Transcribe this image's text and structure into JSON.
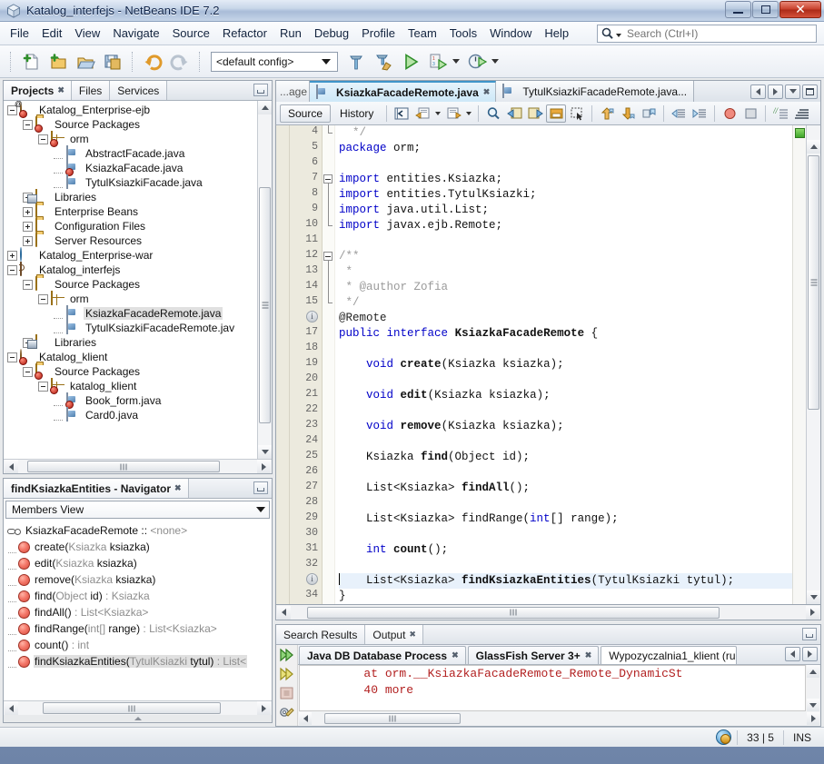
{
  "window": {
    "title": "Katalog_interfejs - NetBeans IDE 7.2",
    "app_icon": "netbeans-cube-icon",
    "minimize_label": "Minimize",
    "maximize_label": "Maximize",
    "close_label": "Close"
  },
  "menubar": {
    "items": [
      "File",
      "Edit",
      "View",
      "Navigate",
      "Source",
      "Refactor",
      "Run",
      "Debug",
      "Profile",
      "Team",
      "Tools",
      "Window",
      "Help"
    ]
  },
  "search": {
    "placeholder": "Search (Ctrl+I)",
    "value": "",
    "icon": "search-icon"
  },
  "toolbar": {
    "buttons": [
      {
        "name": "new-file-button",
        "icon": "new-file-icon",
        "label": "New File"
      },
      {
        "name": "new-project-button",
        "icon": "new-project-icon",
        "label": "New Project"
      },
      {
        "name": "open-project-button",
        "icon": "open-project-icon",
        "label": "Open Project"
      },
      {
        "name": "save-all-button",
        "icon": "save-all-icon",
        "label": "Save All"
      },
      {
        "name": "undo-button",
        "icon": "undo-icon",
        "label": "Undo"
      },
      {
        "name": "redo-button",
        "icon": "redo-icon",
        "label": "Redo"
      }
    ],
    "config_selector": {
      "value": "<default config>",
      "name": "config-selector"
    },
    "run_buttons": [
      {
        "name": "build-project-button",
        "icon": "hammer-icon",
        "label": "Build Project"
      },
      {
        "name": "clean-build-button",
        "icon": "hammer-broom-icon",
        "label": "Clean and Build Project"
      },
      {
        "name": "run-project-button",
        "icon": "play-icon",
        "label": "Run Project"
      },
      {
        "name": "debug-project-button",
        "icon": "debug-icon",
        "label": "Debug Project"
      },
      {
        "name": "profile-project-button",
        "icon": "profile-icon",
        "label": "Profile Project"
      }
    ]
  },
  "projects_panel": {
    "tabs": [
      {
        "label": "Projects",
        "active": true,
        "closable": true
      },
      {
        "label": "Files",
        "active": false,
        "closable": false
      },
      {
        "label": "Services",
        "active": false,
        "closable": false
      }
    ],
    "minimize_icon": "minimize-panel-icon",
    "tree": [
      {
        "label": "Katalog_Enterprise-ejb",
        "depth": 0,
        "state": "expanded",
        "icon": "ejb-module-icon",
        "badge": "error"
      },
      {
        "label": "Source Packages",
        "depth": 1,
        "state": "expanded",
        "icon": "source-packages-icon",
        "badge": "error"
      },
      {
        "label": "orm",
        "depth": 2,
        "state": "expanded",
        "icon": "package-icon",
        "badge": "error"
      },
      {
        "label": "AbstractFacade.java",
        "depth": 3,
        "state": "leaf",
        "icon": "java-file-icon",
        "badge": "none"
      },
      {
        "label": "KsiazkaFacade.java",
        "depth": 3,
        "state": "leaf",
        "icon": "java-file-icon",
        "badge": "error"
      },
      {
        "label": "TytulKsiazkiFacade.java",
        "depth": 3,
        "state": "leaf",
        "icon": "java-file-icon",
        "badge": "none"
      },
      {
        "label": "Libraries",
        "depth": 1,
        "state": "collapsed",
        "icon": "libraries-icon",
        "badge": "none"
      },
      {
        "label": "Enterprise Beans",
        "depth": 1,
        "state": "collapsed",
        "icon": "enterprise-beans-icon",
        "badge": "none"
      },
      {
        "label": "Configuration Files",
        "depth": 1,
        "state": "collapsed",
        "icon": "config-files-icon",
        "badge": "none"
      },
      {
        "label": "Server Resources",
        "depth": 1,
        "state": "collapsed",
        "icon": "server-resources-icon",
        "badge": "none"
      },
      {
        "label": "Katalog_Enterprise-war",
        "depth": 0,
        "state": "collapsed",
        "icon": "web-module-icon",
        "badge": "none"
      },
      {
        "label": "Katalog_interfejs",
        "depth": 0,
        "state": "expanded",
        "icon": "java-project-icon",
        "badge": "none"
      },
      {
        "label": "Source Packages",
        "depth": 1,
        "state": "expanded",
        "icon": "source-packages-icon",
        "badge": "none"
      },
      {
        "label": "orm",
        "depth": 2,
        "state": "expanded",
        "icon": "package-icon",
        "badge": "none"
      },
      {
        "label": "KsiazkaFacadeRemote.java",
        "depth": 3,
        "state": "leaf",
        "icon": "java-file-icon",
        "badge": "none",
        "selected": true
      },
      {
        "label": "TytulKsiazkiFacadeRemote.jav",
        "depth": 3,
        "state": "leaf",
        "icon": "java-file-icon",
        "badge": "none"
      },
      {
        "label": "Libraries",
        "depth": 1,
        "state": "collapsed",
        "icon": "libraries-icon",
        "badge": "none"
      },
      {
        "label": "Katalog_klient",
        "depth": 0,
        "state": "expanded",
        "icon": "client-project-icon",
        "badge": "error"
      },
      {
        "label": "Source Packages",
        "depth": 1,
        "state": "expanded",
        "icon": "source-packages-icon",
        "badge": "error"
      },
      {
        "label": "katalog_klient",
        "depth": 2,
        "state": "expanded",
        "icon": "package-icon",
        "badge": "error"
      },
      {
        "label": "Book_form.java",
        "depth": 3,
        "state": "leaf",
        "icon": "java-file-icon",
        "badge": "error",
        "overlay": "@"
      },
      {
        "label": "Card0.java",
        "depth": 3,
        "state": "leaf",
        "icon": "java-file-icon",
        "badge": "none",
        "overlay": "@"
      }
    ]
  },
  "navigator_panel": {
    "tab_label": "findKsiazkaEntities - Navigator",
    "view_selector": "Members View",
    "minimize_icon": "minimize-panel-icon",
    "members": [
      {
        "icon": "interface-icon",
        "name": "KsiazkaFacadeRemote",
        "sep": " :: ",
        "type": "<none>",
        "kind": "class",
        "selected": false
      },
      {
        "icon": "method-icon",
        "name": "create(",
        "params": "Ksiazka",
        "params_tail": " ksiazka)",
        "ret": "",
        "selected": false
      },
      {
        "icon": "method-icon",
        "name": "edit(",
        "params": "Ksiazka",
        "params_tail": " ksiazka)",
        "ret": "",
        "selected": false
      },
      {
        "icon": "method-icon",
        "name": "remove(",
        "params": "Ksiazka",
        "params_tail": " ksiazka)",
        "ret": "",
        "selected": false
      },
      {
        "icon": "method-icon",
        "name": "find(",
        "params": "Object",
        "params_tail": " id)",
        "ret": " : Ksiazka",
        "selected": false
      },
      {
        "icon": "method-icon",
        "name": "findAll()",
        "params": "",
        "params_tail": "",
        "ret": " : List<Ksiazka>",
        "selected": false
      },
      {
        "icon": "method-icon",
        "name": "findRange(",
        "params": "int[]",
        "params_tail": " range)",
        "ret": " : List<Ksiazka>",
        "selected": false
      },
      {
        "icon": "method-icon",
        "name": "count()",
        "params": "",
        "params_tail": "",
        "ret": " : int",
        "selected": false
      },
      {
        "icon": "method-icon",
        "name": "findKsiazkaEntities(",
        "params": "TytulKsiazki",
        "params_tail": " tytul)",
        "ret": " : List<",
        "selected": true
      }
    ]
  },
  "editor": {
    "tabs": [
      {
        "label": "...age",
        "active": false,
        "truncated": true,
        "icon": "java-file-icon"
      },
      {
        "label": "KsiazkaFacadeRemote.java",
        "active": true,
        "closable": true,
        "icon": "java-file-icon"
      },
      {
        "label": "TytulKsiazkiFacadeRemote.java...",
        "active": false,
        "closable": false,
        "icon": "java-file-icon"
      }
    ],
    "nav_buttons": [
      {
        "name": "scroll-tabs-left-button",
        "icon": "chevron-left-icon"
      },
      {
        "name": "scroll-tabs-right-button",
        "icon": "chevron-right-icon"
      },
      {
        "name": "document-list-button",
        "icon": "chevron-down-icon"
      },
      {
        "name": "maximize-editor-button",
        "icon": "maximize-icon"
      }
    ],
    "view_tabs": [
      {
        "label": "Source",
        "active": true
      },
      {
        "label": "History",
        "active": false
      }
    ],
    "tool_buttons": [
      {
        "name": "last-edit-button",
        "icon": "last-edit-icon"
      },
      {
        "name": "back-button",
        "icon": "back-doc-icon"
      },
      {
        "name": "forward-button",
        "icon": "forward-doc-icon"
      },
      {
        "name": "find-selection-button",
        "icon": "magnifier-icon"
      },
      {
        "name": "find-previous-button",
        "icon": "find-previous-icon"
      },
      {
        "name": "find-next-button",
        "icon": "find-next-icon"
      },
      {
        "name": "toggle-highlight-button",
        "icon": "toggle-highlight-icon"
      },
      {
        "name": "toggle-rect-selection-button",
        "icon": "rect-selection-icon"
      },
      {
        "name": "previous-bookmark-button",
        "icon": "arrow-up-bookmark-icon"
      },
      {
        "name": "next-bookmark-button",
        "icon": "arrow-down-bookmark-icon"
      },
      {
        "name": "toggle-bookmark-button",
        "icon": "bookmark-icon"
      },
      {
        "name": "shift-left-button",
        "icon": "shift-left-icon"
      },
      {
        "name": "shift-right-button",
        "icon": "shift-right-icon"
      },
      {
        "name": "start-macro-recording-button",
        "icon": "record-icon"
      },
      {
        "name": "stop-macro-recording-button",
        "icon": "stop-icon"
      },
      {
        "name": "comment-button",
        "icon": "comment-icon"
      },
      {
        "name": "uncomment-button",
        "icon": "uncomment-icon"
      }
    ],
    "error_status": "ok",
    "lines": [
      {
        "num": "4",
        "fold": "end",
        "text": "  */",
        "cls": "cmt"
      },
      {
        "num": "5",
        "fold": "",
        "text": "package orm;",
        "kind": "package"
      },
      {
        "num": "6",
        "fold": "",
        "text": ""
      },
      {
        "num": "7",
        "fold": "start",
        "text": "import entities.Ksiazka;",
        "kind": "import"
      },
      {
        "num": "8",
        "fold": "bar",
        "text": "import entities.TytulKsiazki;",
        "kind": "import"
      },
      {
        "num": "9",
        "fold": "bar",
        "text": "import java.util.List;",
        "kind": "import"
      },
      {
        "num": "10",
        "fold": "end",
        "text": "import javax.ejb.Remote;",
        "kind": "import"
      },
      {
        "num": "11",
        "fold": "",
        "text": ""
      },
      {
        "num": "12",
        "fold": "start",
        "text": "/**",
        "cls": "cmt"
      },
      {
        "num": "13",
        "fold": "bar",
        "text": " *",
        "cls": "cmt"
      },
      {
        "num": "14",
        "fold": "bar",
        "text": " * @author Zofia",
        "cls": "cmt"
      },
      {
        "num": "15",
        "fold": "end",
        "text": " */",
        "cls": "cmt"
      },
      {
        "num": "@",
        "fold": "",
        "text": "@Remote",
        "kind": "annotation"
      },
      {
        "num": "17",
        "fold": "",
        "text": "public interface KsiazkaFacadeRemote {",
        "kind": "interface"
      },
      {
        "num": "18",
        "fold": "",
        "text": ""
      },
      {
        "num": "19",
        "fold": "",
        "text": "    void create(Ksiazka ksiazka);",
        "kind": "method_void"
      },
      {
        "num": "20",
        "fold": "",
        "text": ""
      },
      {
        "num": "21",
        "fold": "",
        "text": "    void edit(Ksiazka ksiazka);",
        "kind": "method_void"
      },
      {
        "num": "22",
        "fold": "",
        "text": ""
      },
      {
        "num": "23",
        "fold": "",
        "text": "    void remove(Ksiazka ksiazka);",
        "kind": "method_void"
      },
      {
        "num": "24",
        "fold": "",
        "text": ""
      },
      {
        "num": "25",
        "fold": "",
        "text": "    Ksiazka find(Object id);",
        "kind": "method_plain"
      },
      {
        "num": "26",
        "fold": "",
        "text": ""
      },
      {
        "num": "27",
        "fold": "",
        "text": "    List<Ksiazka> findAll();",
        "kind": "method_plain"
      },
      {
        "num": "28",
        "fold": "",
        "text": ""
      },
      {
        "num": "29",
        "fold": "",
        "text": "    List<Ksiazka> findRange(int[] range);",
        "kind": "method_int"
      },
      {
        "num": "30",
        "fold": "",
        "text": ""
      },
      {
        "num": "31",
        "fold": "",
        "text": "    int count();",
        "kind": "method_intcount"
      },
      {
        "num": "32",
        "fold": "",
        "text": ""
      },
      {
        "num": "@",
        "fold": "",
        "text": "    List<Ksiazka> findKsiazkaEntities(TytulKsiazki tytul);",
        "kind": "method_highlight",
        "highlight": true
      },
      {
        "num": "34",
        "fold": "",
        "text": "}"
      }
    ]
  },
  "output_panel": {
    "tabs": [
      {
        "label": "Search Results",
        "active": false,
        "closable": false
      },
      {
        "label": "Output",
        "active": true,
        "closable": true
      }
    ],
    "minimize_icon": "minimize-panel-icon",
    "process_tabs": [
      {
        "label": "Java DB Database Process",
        "active": false,
        "bold": true,
        "closable": true
      },
      {
        "label": "GlassFish Server 3+",
        "active": false,
        "bold": true,
        "closable": true
      },
      {
        "label": "Wypozyczalnia1_klient (ru",
        "active": true,
        "bold": false,
        "closable": false
      }
    ],
    "scroll_buttons": [
      {
        "name": "output-tabs-left-button",
        "icon": "chevron-left-icon"
      },
      {
        "name": "output-tabs-right-button",
        "icon": "chevron-right-icon"
      }
    ],
    "side_buttons": [
      {
        "name": "rerun-button",
        "icon": "double-arrow-green-icon"
      },
      {
        "name": "rerun-alt-button",
        "icon": "double-arrow-yellow-icon"
      },
      {
        "name": "stop-process-button",
        "icon": "stop-square-icon"
      },
      {
        "name": "process-settings-button",
        "icon": "gear-wrench-icon"
      }
    ],
    "lines": [
      "        at orm.__KsiazkaFacadeRemote_Remote_DynamicSt",
      "        40 more"
    ]
  },
  "statusbar": {
    "notify_icon": "refresh-globe-icon",
    "caret_position": "33 | 5",
    "insert_mode": "INS"
  }
}
